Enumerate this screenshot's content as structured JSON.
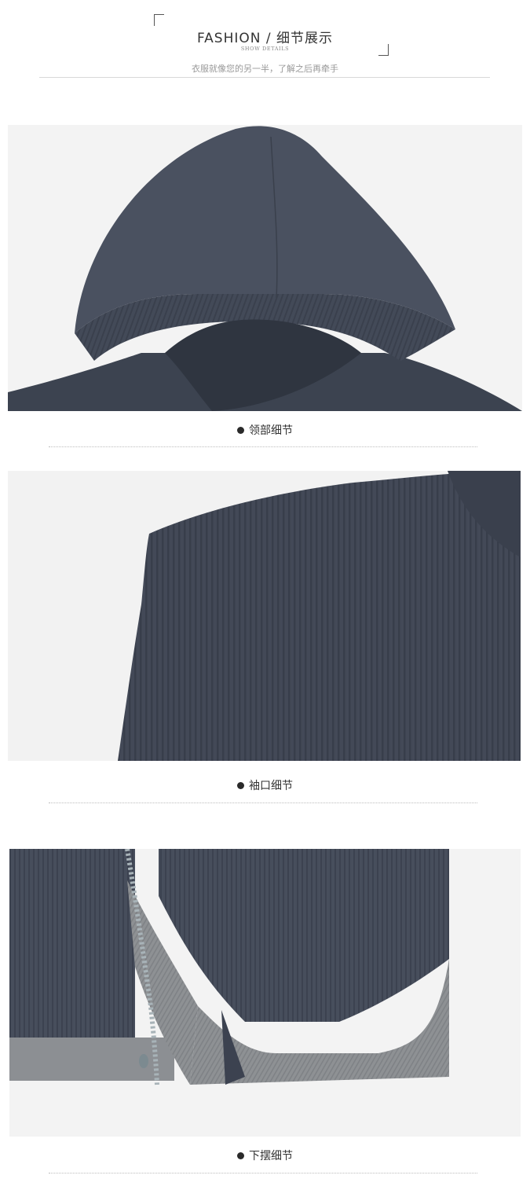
{
  "header": {
    "title": "FASHION / 细节展示",
    "subtitle_en": "SHOW DETAILS",
    "tagline": "衣服就像您的另一半，了解之后再牵手"
  },
  "sections": [
    {
      "caption": "领部细节",
      "image_desc_icon": "hood-photo"
    },
    {
      "caption": "袖口细节",
      "image_desc_icon": "cuff-photo"
    },
    {
      "caption": "下摆细节",
      "image_desc_icon": "hem-photo"
    }
  ],
  "colors": {
    "knit_dark": "#3f4654",
    "knit_grey": "#8f9295",
    "background": "#f4f4f4"
  }
}
